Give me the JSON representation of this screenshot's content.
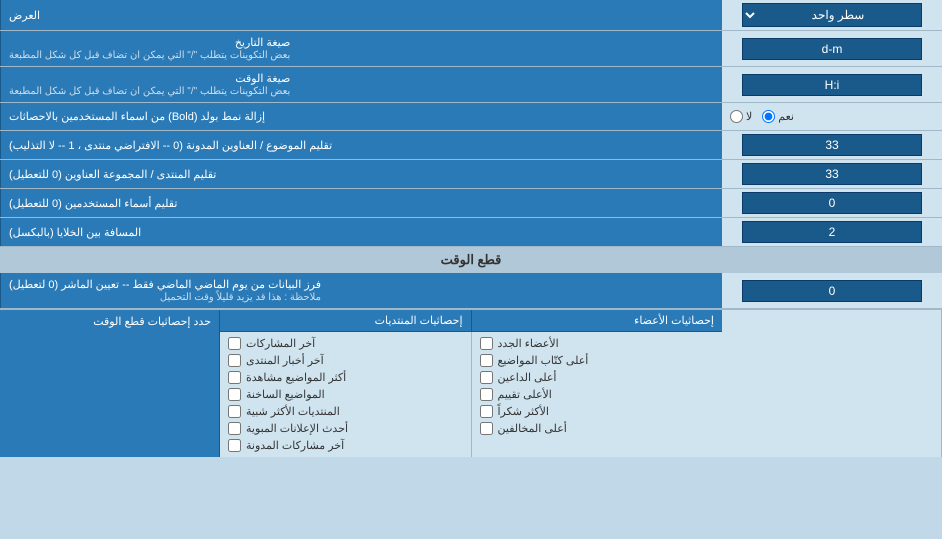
{
  "title": "العرض",
  "rows": [
    {
      "label": "العرض",
      "type": "select",
      "value": "سطر واحد"
    },
    {
      "label": "صيغة التاريخ\nبعض التكوينات يتطلب \"/\" التي يمكن ان تضاف قبل كل شكل المطبعة",
      "type": "input",
      "value": "d-m"
    },
    {
      "label": "صيغة الوقت\nبعض التكوينات يتطلب \"/\" التي يمكن ان تضاف قبل كل شكل المطبعة",
      "type": "input",
      "value": "H:i"
    },
    {
      "label": "إزالة نمط بولد (Bold) من اسماء المستخدمين بالاحصاثات",
      "type": "radio",
      "options": [
        "نعم",
        "لا"
      ],
      "selected": "نعم"
    },
    {
      "label": "تقليم الموضوع / العناوين المدونة (0 -- الافتراضي منتدى ، 1 -- لا التذليب)",
      "type": "input",
      "value": "33"
    },
    {
      "label": "تقليم المنتدى / المجموعة العناوين (0 للتعطيل)",
      "type": "input",
      "value": "33"
    },
    {
      "label": "تقليم أسماء المستخدمين (0 للتعطيل)",
      "type": "input",
      "value": "0"
    },
    {
      "label": "المسافة بين الخلايا (بالبكسل)",
      "type": "input",
      "value": "2"
    }
  ],
  "time_section": {
    "header": "قطع الوقت",
    "row": {
      "label": "فرز البيانات من يوم الماضي الماضي فقط -- تعيين الماشر (0 لتعطيل)\nملاحظة : هذا قد يزيد قليلاً وقت التحميل",
      "value": "0"
    }
  },
  "stats_section": {
    "label": "حدد إحصاثيات قطع الوقت",
    "col1_header": "إحصاثيات الأعضاء",
    "col2_header": "إحصاثيات المنتديات",
    "col1_items": [
      "الأعضاء الجدد",
      "أعلى كتّاب المواضيع",
      "أعلى الداعين",
      "الأعلى تقييم",
      "الأكثر شكراً",
      "أعلى المخالفين"
    ],
    "col2_items": [
      "آخر المشاركات",
      "آخر أخبار المنتدى",
      "أكثر المواضيع مشاهدة",
      "المواضيع الساخنة",
      "المنتديات الأكثر شبية",
      "أحدث الإعلانات المبوية",
      "آخر مشاركات المدونة"
    ]
  },
  "labels": {
    "display": "العرض",
    "date_format": "صيغة التاريخ",
    "date_note": "بعض التكوينات يتطلب \"/\" التي يمكن ان تضاف قبل كل شكل المطبعة",
    "time_format": "صيغة الوقت",
    "time_note": "بعض التكوينات يتطلب \"/\" التي يمكن ان تضاف قبل كل شكل المطبعة",
    "bold_remove": "إزالة نمط بولد (Bold) من اسماء المستخدمين بالاحصاثات",
    "yes": "نعم",
    "no": "لا",
    "trim_title": "تقليم الموضوع / العناوين المدونة (0 -- الافتراضي منتدى ، 1 -- لا التذليب)",
    "trim_forum": "تقليم المنتدى / المجموعة العناوين (0 للتعطيل)",
    "trim_users": "تقليم أسماء المستخدمين (0 للتعطيل)",
    "cell_space": "المسافة بين الخلايا (بالبكسل)"
  }
}
